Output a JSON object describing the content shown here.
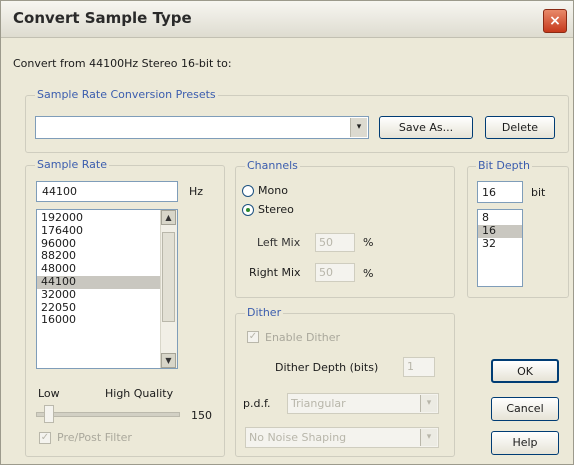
{
  "window": {
    "title": "Convert Sample Type",
    "close_glyph": "×"
  },
  "convert_from": "Convert from 44100Hz Stereo 16-bit to:",
  "presets": {
    "legend": "Sample Rate Conversion Presets",
    "value": "",
    "arrow_glyph": "▾",
    "save_as": "Save As...",
    "delete": "Delete"
  },
  "sample_rate": {
    "legend": "Sample Rate",
    "value": "44100",
    "unit": "Hz",
    "items": [
      "192000",
      "176400",
      "96000",
      "88200",
      "48000",
      "44100",
      "32000",
      "22050",
      "16000"
    ],
    "selected": "44100",
    "scroll_up": "▲",
    "scroll_down": "▼",
    "low_label": "Low",
    "high_label": "High Quality",
    "quality_value": "150",
    "prepost_filter": "Pre/Post Filter"
  },
  "channels": {
    "legend": "Channels",
    "mono": "Mono",
    "stereo": "Stereo",
    "selected": "Stereo",
    "left_mix_label": "Left Mix",
    "left_mix_value": "50",
    "right_mix_label": "Right Mix",
    "right_mix_value": "50",
    "percent": "%"
  },
  "bit_depth": {
    "legend": "Bit Depth",
    "value": "16",
    "unit": "bit",
    "items": [
      "8",
      "16",
      "32"
    ],
    "selected": "16"
  },
  "dither": {
    "legend": "Dither",
    "enable": "Enable Dither",
    "depth_label": "Dither Depth (bits)",
    "depth_value": "1",
    "pdf_label": "p.d.f.",
    "pdf_value": "Triangular",
    "shaping_value": "No Noise Shaping"
  },
  "buttons": {
    "ok": "OK",
    "cancel": "Cancel",
    "help": "Help"
  }
}
